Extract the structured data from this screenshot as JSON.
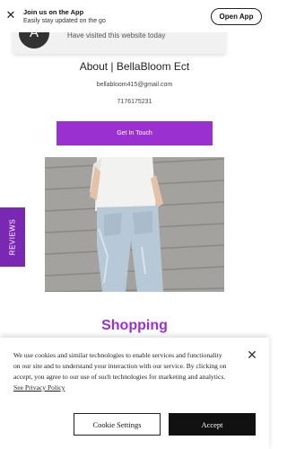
{
  "app_banner": {
    "title": "Join us on the App",
    "subtitle": "Easily stay updated on the go",
    "open_label": "Open App",
    "close_glyph": "✕"
  },
  "visited_toast": {
    "avatar_glyph": "A",
    "text": "Have visited this website today"
  },
  "about": {
    "title": "About | BellaBloom Ect",
    "email": "bellabloom415@gmail.com",
    "phone": "7176175231",
    "cta_label": "Get In Touch"
  },
  "reviews_tab": {
    "label": "REVIEWS"
  },
  "section_heading": "Shopping",
  "cookie_banner": {
    "text": "We use cookies and similar technologies to enable services and functionality on our site and to understand your interaction with our service. By clicking on accept, you agree to our use of such technologies for marketing and analytics.",
    "link_label": "See Privacy Policy",
    "settings_label": "Cookie Settings",
    "accept_label": "Accept",
    "close_glyph": "✕"
  },
  "colors": {
    "accent": "#9b30d0",
    "reviews_tab": "#7a28b3"
  }
}
